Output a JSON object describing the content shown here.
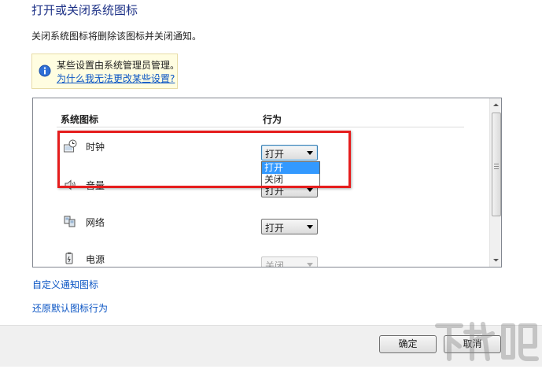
{
  "page": {
    "title": "打开或关闭系统图标",
    "description": "关闭系统图标将删除该图标并关闭通知。"
  },
  "info": {
    "text": "某些设置由系统管理员管理。",
    "link": "为什么我无法更改某些设置?"
  },
  "table": {
    "headers": {
      "icons": "系统图标",
      "behavior": "行为"
    },
    "rows": [
      {
        "label": "时钟",
        "icon": "clock-icon",
        "value": "打开",
        "state": "focused"
      },
      {
        "label": "音量",
        "icon": "speaker-icon",
        "value": "打开",
        "state": "partially-hidden"
      },
      {
        "label": "网络",
        "icon": "network-icon",
        "value": "打开",
        "state": "enabled"
      },
      {
        "label": "电源",
        "icon": "power-icon",
        "value": "关闭",
        "state": "disabled"
      }
    ],
    "dropdown_options": [
      "打开",
      "关闭"
    ],
    "highlighted_option": "打开"
  },
  "links": {
    "customize": "自定义通知图标",
    "restore": "还原默认图标行为"
  },
  "buttons": {
    "ok": "确定",
    "cancel": "取消"
  },
  "colors": {
    "title": "#1e3287",
    "link": "#0b55c4",
    "highlight_border": "#e51d1d",
    "selected_option": "#3399ff"
  }
}
